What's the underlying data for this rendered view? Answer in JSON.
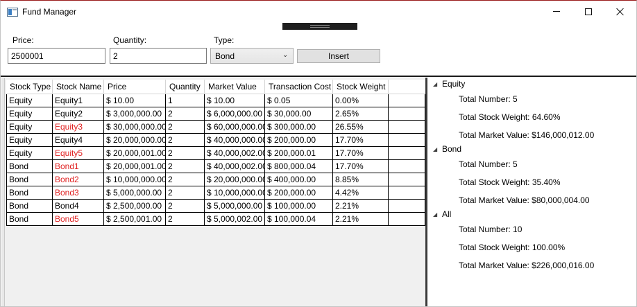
{
  "window": {
    "title": "Fund Manager"
  },
  "form": {
    "price_label": "Price:",
    "price_value": "2500001",
    "quantity_label": "Quantity:",
    "quantity_value": "2",
    "type_label": "Type:",
    "type_selected": "Bond",
    "insert_label": "Insert"
  },
  "grid": {
    "columns": [
      "Stock Type",
      "Stock Name",
      "Price",
      "Quantity",
      "Market Value",
      "Transaction Cost",
      "Stock Weight"
    ],
    "rows": [
      {
        "type": "Equity",
        "name": "Equity1",
        "price": "$ 10.00",
        "qty": "1",
        "mv": "$ 10.00",
        "tc": "$ 0.05",
        "weight": "0.00%",
        "highlight": false
      },
      {
        "type": "Equity",
        "name": "Equity2",
        "price": "$ 3,000,000.00",
        "qty": "2",
        "mv": "$ 6,000,000.00",
        "tc": "$ 30,000.00",
        "weight": "2.65%",
        "highlight": false
      },
      {
        "type": "Equity",
        "name": "Equity3",
        "price": "$ 30,000,000.00",
        "qty": "2",
        "mv": "$ 60,000,000.00",
        "tc": "$ 300,000.00",
        "weight": "26.55%",
        "highlight": true
      },
      {
        "type": "Equity",
        "name": "Equity4",
        "price": "$ 20,000,000.00",
        "qty": "2",
        "mv": "$ 40,000,000.00",
        "tc": "$ 200,000.00",
        "weight": "17.70%",
        "highlight": false
      },
      {
        "type": "Equity",
        "name": "Equity5",
        "price": "$ 20,000,001.00",
        "qty": "2",
        "mv": "$ 40,000,002.00",
        "tc": "$ 200,000.01",
        "weight": "17.70%",
        "highlight": true
      },
      {
        "type": "Bond",
        "name": "Bond1",
        "price": "$ 20,000,001.00",
        "qty": "2",
        "mv": "$ 40,000,002.00",
        "tc": "$ 800,000.04",
        "weight": "17.70%",
        "highlight": true
      },
      {
        "type": "Bond",
        "name": "Bond2",
        "price": "$ 10,000,000.00",
        "qty": "2",
        "mv": "$ 20,000,000.00",
        "tc": "$ 400,000.00",
        "weight": "8.85%",
        "highlight": true
      },
      {
        "type": "Bond",
        "name": "Bond3",
        "price": "$ 5,000,000.00",
        "qty": "2",
        "mv": "$ 10,000,000.00",
        "tc": "$ 200,000.00",
        "weight": "4.42%",
        "highlight": true
      },
      {
        "type": "Bond",
        "name": "Bond4",
        "price": "$ 2,500,000.00",
        "qty": "2",
        "mv": "$ 5,000,000.00",
        "tc": "$ 100,000.00",
        "weight": "2.21%",
        "highlight": false
      },
      {
        "type": "Bond",
        "name": "Bond5",
        "price": "$ 2,500,001.00",
        "qty": "2",
        "mv": "$ 5,000,002.00",
        "tc": "$ 100,000.04",
        "weight": "2.21%",
        "highlight": true
      }
    ]
  },
  "summary": [
    {
      "label": "Equity",
      "number": "Total Number: 5",
      "weight": "Total Stock Weight: 64.60%",
      "market": "Total Market Value: $146,000,012.00"
    },
    {
      "label": "Bond",
      "number": "Total Number: 5",
      "weight": "Total Stock Weight: 35.40%",
      "market": "Total Market Value: $80,000,004.00"
    },
    {
      "label": "All",
      "number": "Total Number: 10",
      "weight": "Total Stock Weight: 100.00%",
      "market": "Total Market Value: $226,000,016.00"
    }
  ],
  "colors": {
    "highlight": "#e02020",
    "expand_glyph": "◢"
  }
}
